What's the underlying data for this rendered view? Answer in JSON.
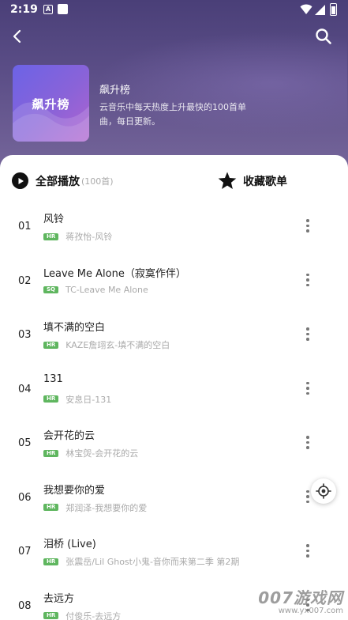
{
  "status_bar": {
    "time": "2:19",
    "notification_letter": "A"
  },
  "header": {
    "back_icon": "back-arrow-icon",
    "search_icon": "search-icon"
  },
  "playlist": {
    "cover_title": "飙升榜",
    "title": "飙升榜",
    "description": "云音乐中每天热度上升最快的100首单曲，每日更新。"
  },
  "actions": {
    "play_all_label": "全部播放",
    "play_all_count": "(100首)",
    "collect_label": "收藏歌单"
  },
  "songs": [
    {
      "index": "01",
      "title": "风铃",
      "badge": "HR",
      "artist": "蒋孜怡-风铃"
    },
    {
      "index": "02",
      "title": "Leave Me Alone（寂寞作伴）",
      "badge": "SQ",
      "artist": "TC-Leave Me Alone"
    },
    {
      "index": "03",
      "title": "填不满的空白",
      "badge": "HR",
      "artist": "KAZE詹翊玄-填不满的空白"
    },
    {
      "index": "04",
      "title": "131",
      "badge": "HR",
      "artist": "安息日-131"
    },
    {
      "index": "05",
      "title": "会开花的云",
      "badge": "HR",
      "artist": "林宝焈-会开花的云"
    },
    {
      "index": "06",
      "title": "我想要你的爱",
      "badge": "HR",
      "artist": "郑润泽-我想要你的爱"
    },
    {
      "index": "07",
      "title": "泪桥 (Live)",
      "badge": "HR",
      "artist": "张震岳/Lil Ghost小鬼-音你而来第二季 第2期"
    },
    {
      "index": "08",
      "title": "去远方",
      "badge": "HR",
      "artist": "付俊乐-去远方"
    }
  ],
  "watermark": {
    "big": "007游戏网",
    "small": "www.yx007.com"
  },
  "colors": {
    "header": "#4a3f78",
    "badge": "#5fb65f",
    "accent": "#111111"
  }
}
